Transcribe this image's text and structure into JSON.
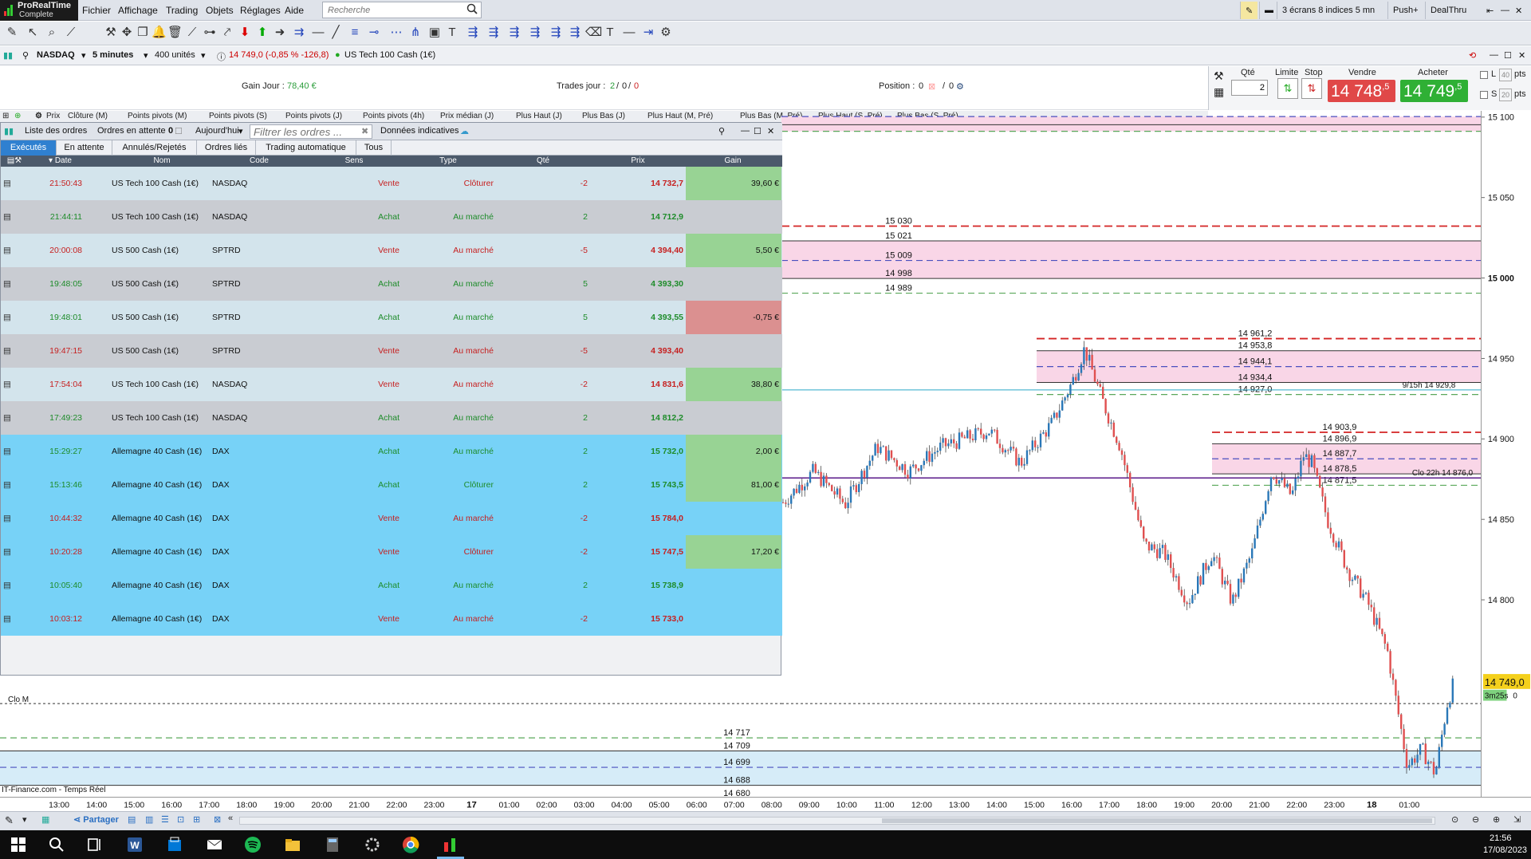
{
  "app": {
    "name": "ProRealTime",
    "edition": "Complete"
  },
  "menu": [
    "Fichier",
    "Affichage",
    "Trading",
    "Objets",
    "Réglages",
    "Aide"
  ],
  "search": {
    "placeholder": "Recherche"
  },
  "top_right": {
    "workspace": "3 écrans 8 indices 5 mn",
    "plus": "Push+",
    "dealthru": "DealThru"
  },
  "instrument": {
    "symbol": "NASDAQ",
    "timeframe": "5 minutes",
    "units": "400 unités",
    "quote": "14 749,0 (-0,85 % -126,8)",
    "name": "US Tech 100 Cash (1€)"
  },
  "info": {
    "gain_label": "Gain Jour :",
    "gain_value": "78,40 €",
    "trades_label": "Trades jour :",
    "trades_a": "2",
    "trades_b": "0",
    "trades_c": "0",
    "position_label": "Position :",
    "position_value": "0",
    "position_b": "0",
    "sep": "/"
  },
  "order_panel": {
    "qte_label": "Qté",
    "qte_value": "2",
    "limite_label": "Limite",
    "stop_label": "Stop",
    "sell_label": "Vendre",
    "buy_label": "Acheter",
    "sell_price": "14 748",
    "sell_frac": ",5",
    "buy_price": "14 749",
    "buy_frac": ",5",
    "l_label": "L",
    "l_val": "40",
    "s_label": "S",
    "s_val": "20",
    "pts": "pts"
  },
  "indicators": [
    "Prix",
    "Clôture (M)",
    "Points pivots (M)",
    "Points pivots (S)",
    "Points pivots (J)",
    "Points pivots (4h)",
    "Prix médian (J)",
    "Plus Haut (J)",
    "Plus Bas (J)",
    "Plus Haut (M, Pré)",
    "Plus Bas (M, Pré)",
    "Plus Haut (S, Pré)",
    "Plus Bas (S, Pré)"
  ],
  "orders_window": {
    "title": "Liste des ordres",
    "pending": "Ordres en attente",
    "pending_count": "0",
    "period": "Aujourd'hui",
    "filter_placeholder": "Filtrer les ordres ...",
    "indicative": "Données indicatives",
    "tabs": [
      "Exécutés",
      "En attente",
      "Annulés/Rejetés",
      "Ordres liés",
      "Trading automatique",
      "Tous"
    ],
    "columns": [
      "Date",
      "Nom",
      "Code",
      "Sens",
      "Type",
      "Qté",
      "Prix",
      "Gain"
    ],
    "rows": [
      {
        "time": "21:50:43",
        "name": "US Tech 100 Cash (1€)",
        "code": "NASDAQ",
        "side": "Vente",
        "type": "Clôturer",
        "qty": "-2",
        "price": "14 732,7",
        "gain": "39,60 €",
        "g": "pos"
      },
      {
        "time": "21:44:11",
        "name": "US Tech 100 Cash (1€)",
        "code": "NASDAQ",
        "side": "Achat",
        "type": "Au marché",
        "qty": "2",
        "price": "14 712,9",
        "gain": "",
        "g": ""
      },
      {
        "time": "20:00:08",
        "name": "US 500 Cash (1€)",
        "code": "SPTRD",
        "side": "Vente",
        "type": "Au marché",
        "qty": "-5",
        "price": "4 394,40",
        "gain": "5,50 €",
        "g": "pos"
      },
      {
        "time": "19:48:05",
        "name": "US 500 Cash (1€)",
        "code": "SPTRD",
        "side": "Achat",
        "type": "Au marché",
        "qty": "5",
        "price": "4 393,30",
        "gain": "",
        "g": ""
      },
      {
        "time": "19:48:01",
        "name": "US 500 Cash (1€)",
        "code": "SPTRD",
        "side": "Achat",
        "type": "Au marché",
        "qty": "5",
        "price": "4 393,55",
        "gain": "-0,75 €",
        "g": "neg"
      },
      {
        "time": "19:47:15",
        "name": "US 500 Cash (1€)",
        "code": "SPTRD",
        "side": "Vente",
        "type": "Au marché",
        "qty": "-5",
        "price": "4 393,40",
        "gain": "",
        "g": ""
      },
      {
        "time": "17:54:04",
        "name": "US Tech 100 Cash (1€)",
        "code": "NASDAQ",
        "side": "Vente",
        "type": "Au marché",
        "qty": "-2",
        "price": "14 831,6",
        "gain": "38,80 €",
        "g": "pos"
      },
      {
        "time": "17:49:23",
        "name": "US Tech 100 Cash (1€)",
        "code": "NASDAQ",
        "side": "Achat",
        "type": "Au marché",
        "qty": "2",
        "price": "14 812,2",
        "gain": "",
        "g": ""
      },
      {
        "time": "15:29:27",
        "name": "Allemagne 40 Cash (1€)",
        "code": "DAX",
        "side": "Achat",
        "type": "Au marché",
        "qty": "2",
        "price": "15 732,0",
        "gain": "2,00 €",
        "g": "pos"
      },
      {
        "time": "15:13:46",
        "name": "Allemagne 40 Cash (1€)",
        "code": "DAX",
        "side": "Achat",
        "type": "Clôturer",
        "qty": "2",
        "price": "15 743,5",
        "gain": "81,00 €",
        "g": "pos"
      },
      {
        "time": "10:44:32",
        "name": "Allemagne 40 Cash (1€)",
        "code": "DAX",
        "side": "Vente",
        "type": "Au marché",
        "qty": "-2",
        "price": "15 784,0",
        "gain": "",
        "g": ""
      },
      {
        "time": "10:20:28",
        "name": "Allemagne 40 Cash (1€)",
        "code": "DAX",
        "side": "Vente",
        "type": "Clôturer",
        "qty": "-2",
        "price": "15 747,5",
        "gain": "17,20 €",
        "g": "pos"
      },
      {
        "time": "10:05:40",
        "name": "Allemagne 40 Cash (1€)",
        "code": "DAX",
        "side": "Achat",
        "type": "Au marché",
        "qty": "2",
        "price": "15 738,9",
        "gain": "",
        "g": ""
      },
      {
        "time": "10:03:12",
        "name": "Allemagne 40 Cash (1€)",
        "code": "DAX",
        "side": "Vente",
        "type": "Au marché",
        "qty": "-2",
        "price": "15 733,0",
        "gain": "",
        "g": ""
      }
    ]
  },
  "chart_data": {
    "type": "candlestick",
    "y_ticks": [
      "15 100",
      "15 050",
      "15 000",
      "14 950",
      "14 900",
      "14 850",
      "14 800"
    ],
    "y_range": [
      14670,
      15115
    ],
    "x_ticks": [
      "13:00",
      "14:00",
      "15:00",
      "16:00",
      "17:00",
      "18:00",
      "19:00",
      "20:00",
      "21:00",
      "22:00",
      "23:00",
      "17",
      "01:00",
      "02:00",
      "03:00",
      "04:00",
      "05:00",
      "06:00",
      "07:00",
      "08:00",
      "09:00",
      "10:00",
      "11:00",
      "12:00",
      "13:00",
      "14:00",
      "15:00",
      "16:00",
      "17:00",
      "18:00",
      "19:00",
      "20:00",
      "21:00",
      "22:00",
      "23:00",
      "18",
      "01:00"
    ],
    "levels": [
      {
        "label": "15 030",
        "value": 15030,
        "style": "red-dash"
      },
      {
        "label": "15 021",
        "value": 15021,
        "style": "black"
      },
      {
        "label": "15 009",
        "value": 15009,
        "style": "blue-dash"
      },
      {
        "label": "14 998",
        "value": 14998,
        "style": "black"
      },
      {
        "label": "14 989",
        "value": 14989,
        "style": "green-dash"
      },
      {
        "label": "14 961,2",
        "value": 14961.2,
        "style": "red-dash"
      },
      {
        "label": "14 953,8",
        "value": 14953.8,
        "style": "black"
      },
      {
        "label": "14 944,1",
        "value": 14944.1,
        "style": "blue-dash"
      },
      {
        "label": "14 934,4",
        "value": 14934.4,
        "style": "black"
      },
      {
        "label": "14 927,0",
        "value": 14927,
        "style": "green-dash"
      },
      {
        "label": "14 903,9",
        "value": 14903.9,
        "style": "red-dash"
      },
      {
        "label": "14 896,9",
        "value": 14896.9,
        "style": "black"
      },
      {
        "label": "14 887,7",
        "value": 14887.7,
        "style": "blue-dash"
      },
      {
        "label": "14 878,5",
        "value": 14878.5,
        "style": "black"
      },
      {
        "label": "14 871,5",
        "value": 14871.5,
        "style": "green-dash"
      },
      {
        "label": "14 717",
        "value": 14717,
        "style": "green-dash"
      },
      {
        "label": "14 709",
        "value": 14709,
        "style": "black"
      },
      {
        "label": "14 699",
        "value": 14699,
        "style": "blue-dash"
      },
      {
        "label": "14 688",
        "value": 14688,
        "style": "black"
      },
      {
        "label": "14 680",
        "value": 14680,
        "style": "red-dash"
      }
    ],
    "top_levels": [
      15106,
      15097,
      15092,
      15088
    ],
    "annotations": [
      {
        "label": "9/15h 14 929,8",
        "value": 14929.8
      },
      {
        "label": "Clo 22h 14 876,0",
        "value": 14876
      },
      {
        "label": "Clo M",
        "value": 14738
      }
    ],
    "last_price": "14 749,0",
    "countdown": "3m25s",
    "countdown_suffix": "0",
    "source": "IT-Finance.com - Temps Réel"
  },
  "bottom": {
    "share": "Partager"
  },
  "clock": {
    "time": "21:56",
    "date": "17/08/2023"
  },
  "colors": {
    "up": "#2a78b8",
    "down": "#e05050",
    "pink_zone": "#f9d6e7",
    "blue_zone": "#d6ecf8",
    "row_light": "#d3e4ec",
    "row_dark": "#c9ccd2",
    "row_dax": "#77d2f7",
    "gain_pos": "#98d394",
    "gain_neg": "#db9090"
  }
}
